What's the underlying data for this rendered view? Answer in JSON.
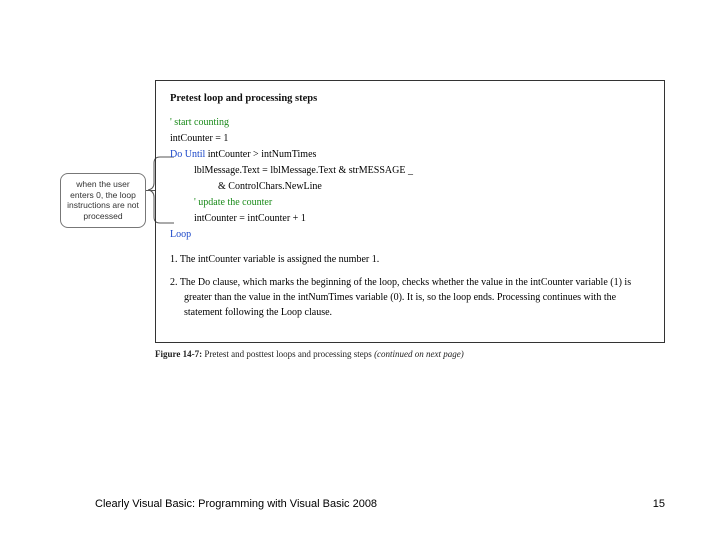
{
  "callout": {
    "text": "when the user enters 0, the loop instructions are not processed"
  },
  "figure": {
    "heading": "Pretest loop and processing steps",
    "code": {
      "c1": "' start counting",
      "l1": "intCounter = 1",
      "kw_do": "Do Until",
      "l2_rest": " intCounter > intNumTimes",
      "l3": "lblMessage.Text = lblMessage.Text & strMESSAGE _",
      "l4": "& ControlChars.NewLine",
      "c2": "' update the counter",
      "l5": "intCounter = intCounter + 1",
      "kw_loop": "Loop"
    },
    "steps": {
      "s1_num": "1.",
      "s1": "The intCounter variable is assigned the number 1.",
      "s2_num": "2.",
      "s2": "The Do clause, which marks the beginning of the loop, checks whether the value in the intCounter variable (1) is greater than the value in the intNumTimes variable (0). It is, so the loop ends. Processing continues with the statement following the Loop clause."
    },
    "caption_label": "Figure 14-7:",
    "caption_text": " Pretest and posttest loops and processing steps ",
    "caption_cont": "(continued on next page)"
  },
  "footer": {
    "text": "Clearly Visual Basic: Programming with Visual Basic 2008",
    "page": "15"
  }
}
